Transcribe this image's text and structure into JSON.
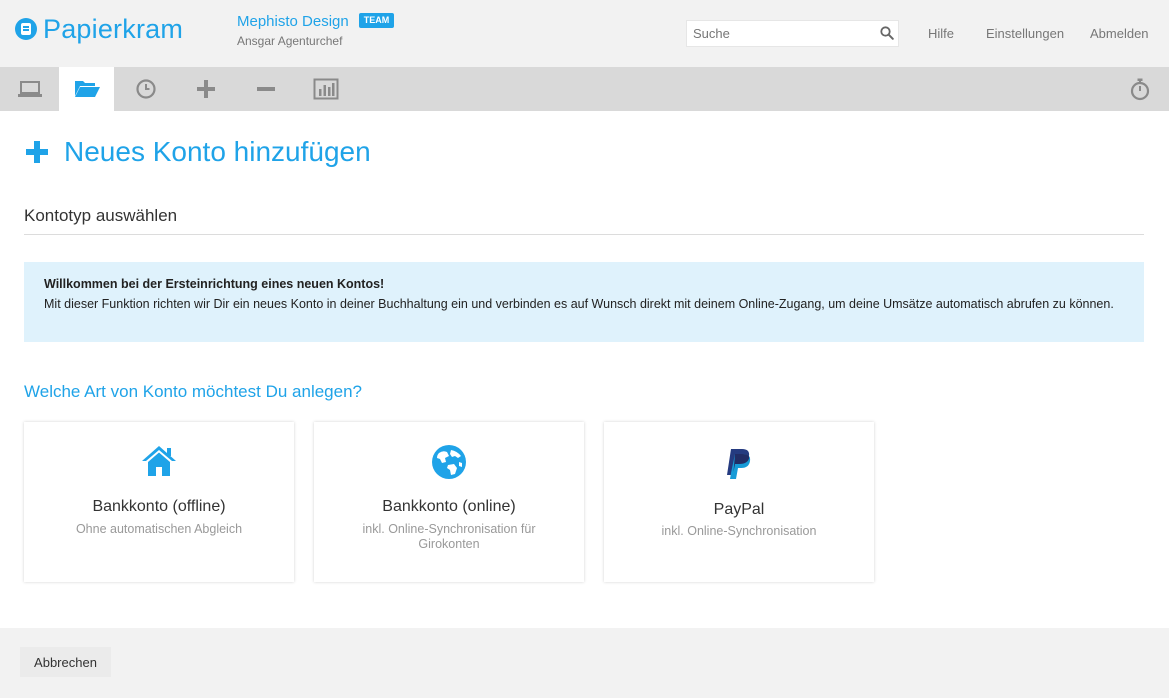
{
  "header": {
    "logo_text": "Papierkram",
    "company_name": "Mephisto Design",
    "team_badge": "TEAM",
    "user_name": "Ansgar Agenturchef",
    "search_placeholder": "Suche",
    "links": {
      "help": "Hilfe",
      "settings": "Einstellungen",
      "logout": "Abmelden"
    }
  },
  "tabbar": {
    "tabs": [
      {
        "icon": "laptop-icon",
        "active": false
      },
      {
        "icon": "folder-open-icon",
        "active": true
      },
      {
        "icon": "clock-icon",
        "active": false
      },
      {
        "icon": "plus-icon",
        "active": false
      },
      {
        "icon": "minus-icon",
        "active": false
      },
      {
        "icon": "bar-chart-icon",
        "active": false
      }
    ],
    "right_icon": "stopwatch-icon"
  },
  "main": {
    "title": "Neues Konto hinzufügen",
    "section_title": "Kontotyp auswählen",
    "info": {
      "heading": "Willkommen bei der Ersteinrichtung eines neuen Kontos!",
      "text": "Mit dieser Funktion richten wir Dir ein neues Konto in deiner Buchhaltung ein und verbinden es auf Wunsch direkt mit deinem Online-Zugang, um deine Umsätze automatisch abrufen zu können."
    },
    "question": "Welche Art von Konto möchtest Du anlegen?",
    "cards": [
      {
        "icon": "house-icon",
        "title": "Bankkonto (offline)",
        "subtitle": "Ohne automatischen Abgleich"
      },
      {
        "icon": "globe-icon",
        "title": "Bankkonto (online)",
        "subtitle": "inkl. Online-Synchronisation für Girokonten"
      },
      {
        "icon": "paypal-icon",
        "title": "PayPal",
        "subtitle": "inkl. Online-Synchronisation"
      }
    ]
  },
  "footer": {
    "cancel_label": "Abbrechen"
  },
  "colors": {
    "accent": "#1fa3e8",
    "info_bg": "#dff2fc",
    "header_bg": "#f2f2f2",
    "tabbar_bg": "#d9d9d9"
  }
}
